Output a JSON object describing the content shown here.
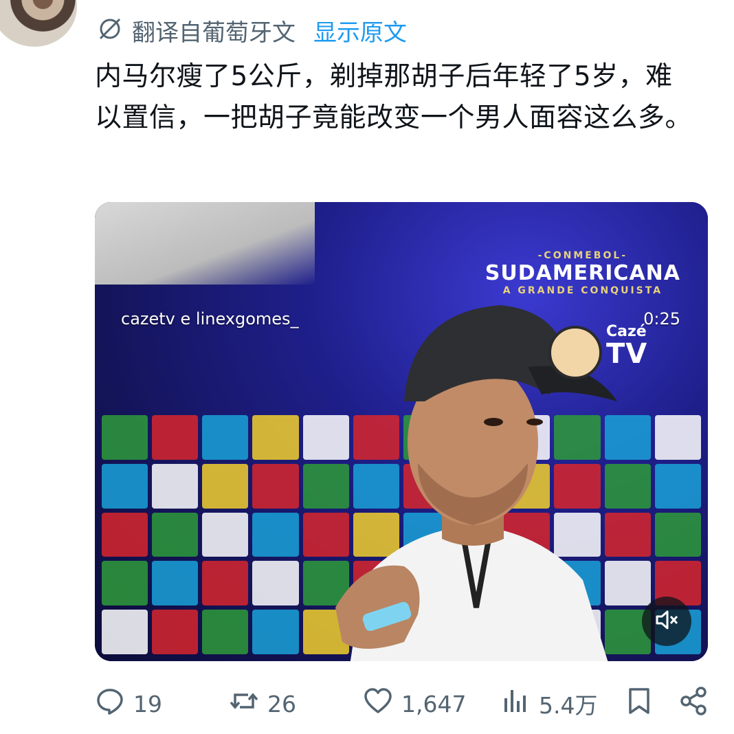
{
  "translate": {
    "label": "翻译自葡萄牙文",
    "show_original": "显示原文"
  },
  "tweet": {
    "text": "内马尔瘦了5公斤，剃掉那胡子后年轻了5岁，难以置信，一把胡子竟能改变一个男人面容这么多。"
  },
  "video": {
    "credit": "cazetv e linexgomes_",
    "time": "0:25",
    "brand_top": "Cazé",
    "brand_bottom": "TV",
    "sponsor_heading": "SUDAMERICANA",
    "sponsor_sub": "-CONMEBOL-",
    "sponsor_tagline": "A GRANDE CONQUISTA"
  },
  "actions": {
    "replies": "19",
    "reposts": "26",
    "likes": "1,647",
    "views": "5.4万"
  },
  "colors": {
    "link": "#1d9bf0",
    "muted": "#536471",
    "text": "#0f1419"
  },
  "icons": [
    "translate-icon",
    "reply-icon",
    "repost-icon",
    "like-icon",
    "views-icon",
    "bookmark-icon",
    "share-icon",
    "mute-icon"
  ]
}
